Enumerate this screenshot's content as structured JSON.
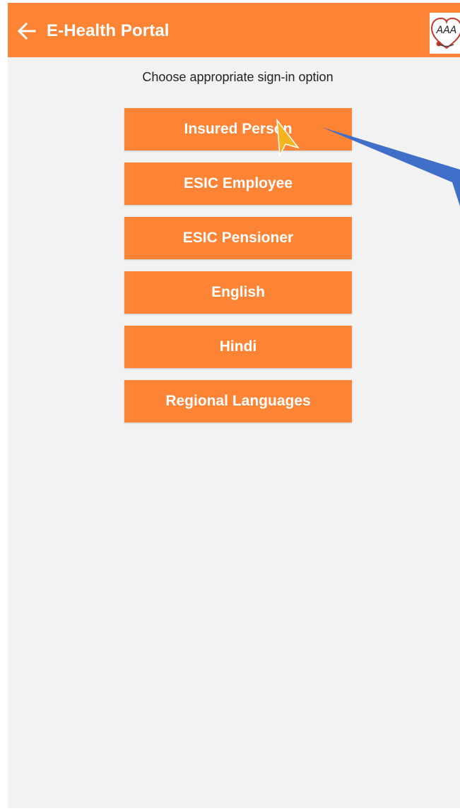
{
  "app_bar": {
    "title": "E-Health Portal",
    "back_icon": "arrow-left-icon",
    "logo_text": "AAA",
    "background": "#fd8335"
  },
  "instruction": "Choose appropriate sign-in option",
  "options": [
    {
      "label": "Insured Person"
    },
    {
      "label": "ESIC Employee"
    },
    {
      "label": "ESIC Pensioner"
    },
    {
      "label": "English"
    },
    {
      "label": "Hindi"
    },
    {
      "label": "Regional Languages"
    }
  ],
  "colors": {
    "accent": "#fd8335",
    "screen_background": "#f2f2f2",
    "annotation_arrow": "#3f6fc8",
    "cursor": "#f5b41e"
  }
}
